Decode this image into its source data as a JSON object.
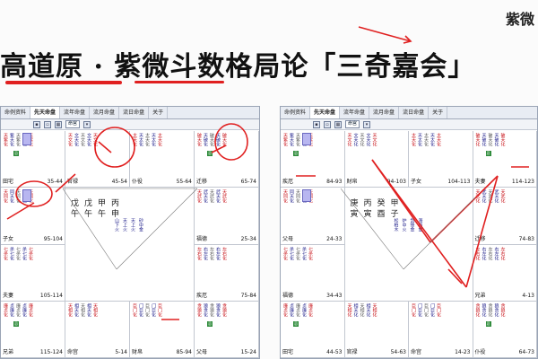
{
  "title": "高道原 · 紫微斗数格局论「三奇嘉会」",
  "watermark": "紫微",
  "left_window": {
    "tabs": [
      "命例资料",
      "先天命盘",
      "流年命盘",
      "流月命盘",
      "流日命盘",
      "关于"
    ],
    "active_tab": 1,
    "select_value": "命宫",
    "center": {
      "row1": [
        "戊",
        "戊",
        "甲",
        "丙"
      ],
      "row2": [
        "午",
        "午",
        "午",
        "申"
      ],
      "cols": [
        "山下火",
        "天上火",
        "天上火",
        "砂中金"
      ]
    },
    "cells": [
      {
        "palace": "田宅",
        "range": "35-44"
      },
      {
        "palace": "官禄",
        "range": "45-54"
      },
      {
        "palace": "仆役",
        "range": "55-64"
      },
      {
        "palace": "迁移",
        "range": "65-74"
      },
      {
        "palace": "福德",
        "range": "25-34"
      },
      {
        "palace": "疾厄",
        "range": "75-84"
      },
      {
        "palace": "父母",
        "range": "15-24"
      },
      {
        "palace": "财帛",
        "range": "85-94"
      },
      {
        "palace": "命宫",
        "range": "5-14"
      },
      {
        "palace": "兄弟",
        "range": "115-124"
      },
      {
        "palace": "夫妻",
        "range": "105-114"
      },
      {
        "palace": "子女",
        "range": "95-104"
      }
    ]
  },
  "right_window": {
    "tabs": [
      "命例资料",
      "先天命盘",
      "流年命盘",
      "流月命盘",
      "流日命盘",
      "关于"
    ],
    "active_tab": 1,
    "select_value": "命宫",
    "center": {
      "row1": [
        "庚",
        "丙",
        "癸",
        "甲"
      ],
      "row2": [
        "寅",
        "寅",
        "酉",
        "子"
      ],
      "cols": [
        "松柏木",
        "炉中火",
        "剑锋金",
        "海中金"
      ]
    },
    "cells": [
      {
        "palace": "疾厄",
        "range": "84-93"
      },
      {
        "palace": "财帛",
        "range": "94-103"
      },
      {
        "palace": "子女",
        "range": "104-113"
      },
      {
        "palace": "夫妻",
        "range": "114-123"
      },
      {
        "palace": "迁移",
        "range": "74-83"
      },
      {
        "palace": "兄弟",
        "range": "4-13"
      },
      {
        "palace": "仆役",
        "range": "64-73"
      },
      {
        "palace": "命宫",
        "range": "14-23"
      },
      {
        "palace": "官禄",
        "range": "54-63"
      },
      {
        "palace": "田宅",
        "range": "44-53"
      },
      {
        "palace": "福德",
        "range": "34-43"
      },
      {
        "palace": "父母",
        "range": "24-33"
      }
    ]
  },
  "colors": {
    "accent": "#e02020",
    "star_blue": "#1d1d8a",
    "star_red": "#c8151b",
    "highlight_purple": "#b8b6f0",
    "badge_green": "#2e8b3a"
  }
}
